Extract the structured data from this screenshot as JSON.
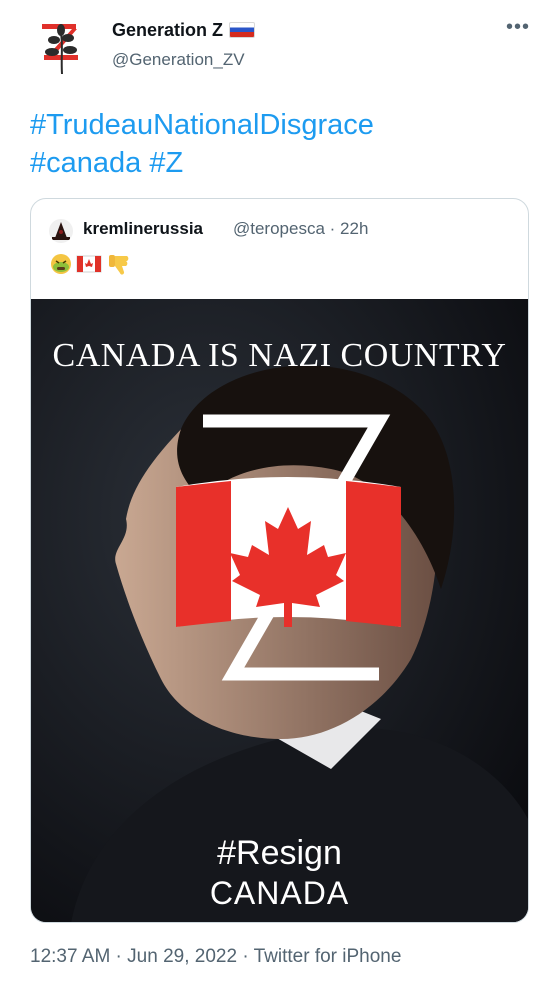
{
  "author": {
    "display_name": "Generation Z",
    "handle": "@Generation_ZV",
    "flag_emoji": "russia-flag"
  },
  "tweet": {
    "hashtags": [
      "#TrudeauNationalDisgrace",
      "#canada",
      "#Z"
    ]
  },
  "quoted_tweet": {
    "display_name": "kremlinerussia",
    "handle": "@teropesca",
    "time_ago": "22h",
    "emojis": [
      "nauseated-face-icon",
      "canada-flag-icon",
      "thumbs-down-icon"
    ],
    "image": {
      "top_text": "CANADA IS NAZI COUNTRY",
      "bottom_line1": "#Resign",
      "bottom_line2": "CANADA"
    }
  },
  "meta": {
    "time": "12:37 AM",
    "date": "Jun 29, 2022",
    "source": "Twitter for iPhone"
  },
  "colors": {
    "link": "#1d9bf0",
    "secondary_text": "#536471",
    "border": "#cfd9de"
  }
}
